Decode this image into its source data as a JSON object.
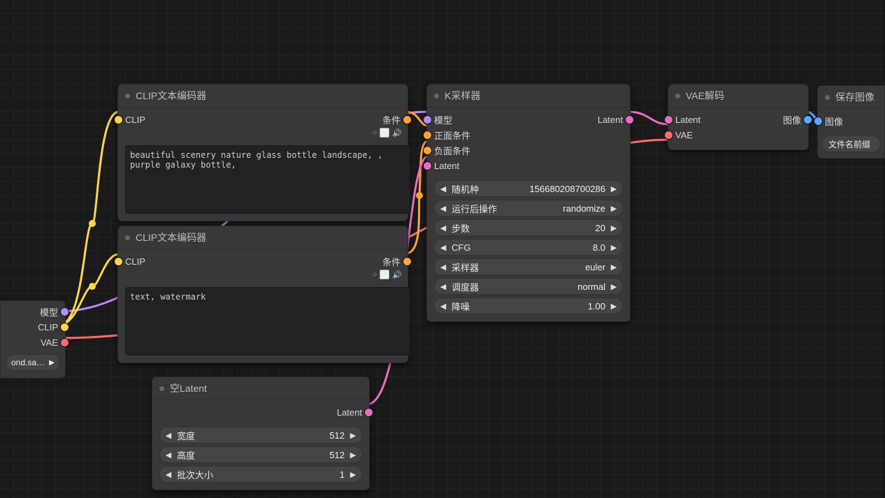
{
  "checkpoint": {
    "outputs": {
      "model": "模型",
      "clip": "CLIP",
      "vae": "VAE"
    },
    "file": "ond.saf…"
  },
  "clip_pos": {
    "title": "CLIP文本编码器",
    "inputs": {
      "clip": "CLIP"
    },
    "outputs": {
      "cond": "条件"
    },
    "text": "beautiful scenery nature glass bottle landscape, , purple galaxy bottle,"
  },
  "clip_neg": {
    "title": "CLIP文本编码器",
    "inputs": {
      "clip": "CLIP"
    },
    "outputs": {
      "cond": "条件"
    },
    "text": "text, watermark"
  },
  "empty_latent": {
    "title": "空Latent",
    "outputs": {
      "latent": "Latent"
    },
    "params": [
      {
        "label": "宽度",
        "value": "512"
      },
      {
        "label": "高度",
        "value": "512"
      },
      {
        "label": "批次大小",
        "value": "1"
      }
    ]
  },
  "ksampler": {
    "title": "K采样器",
    "inputs": {
      "model": "模型",
      "positive": "正面条件",
      "negative": "负面条件",
      "latent": "Latent"
    },
    "outputs": {
      "latent": "Latent"
    },
    "params": [
      {
        "label": "随机种",
        "value": "156680208700286"
      },
      {
        "label": "运行后操作",
        "value": "randomize"
      },
      {
        "label": "步数",
        "value": "20"
      },
      {
        "label": "CFG",
        "value": "8.0"
      },
      {
        "label": "采样器",
        "value": "euler"
      },
      {
        "label": "调度器",
        "value": "normal"
      },
      {
        "label": "降噪",
        "value": "1.00"
      }
    ]
  },
  "vae_decode": {
    "title": "VAE解码",
    "inputs": {
      "latent": "Latent",
      "vae": "VAE"
    },
    "outputs": {
      "image": "图像"
    }
  },
  "save_image": {
    "title": "保存图像",
    "inputs": {
      "image": "图像"
    },
    "params": [
      {
        "label": "文件名前缀"
      }
    ]
  }
}
